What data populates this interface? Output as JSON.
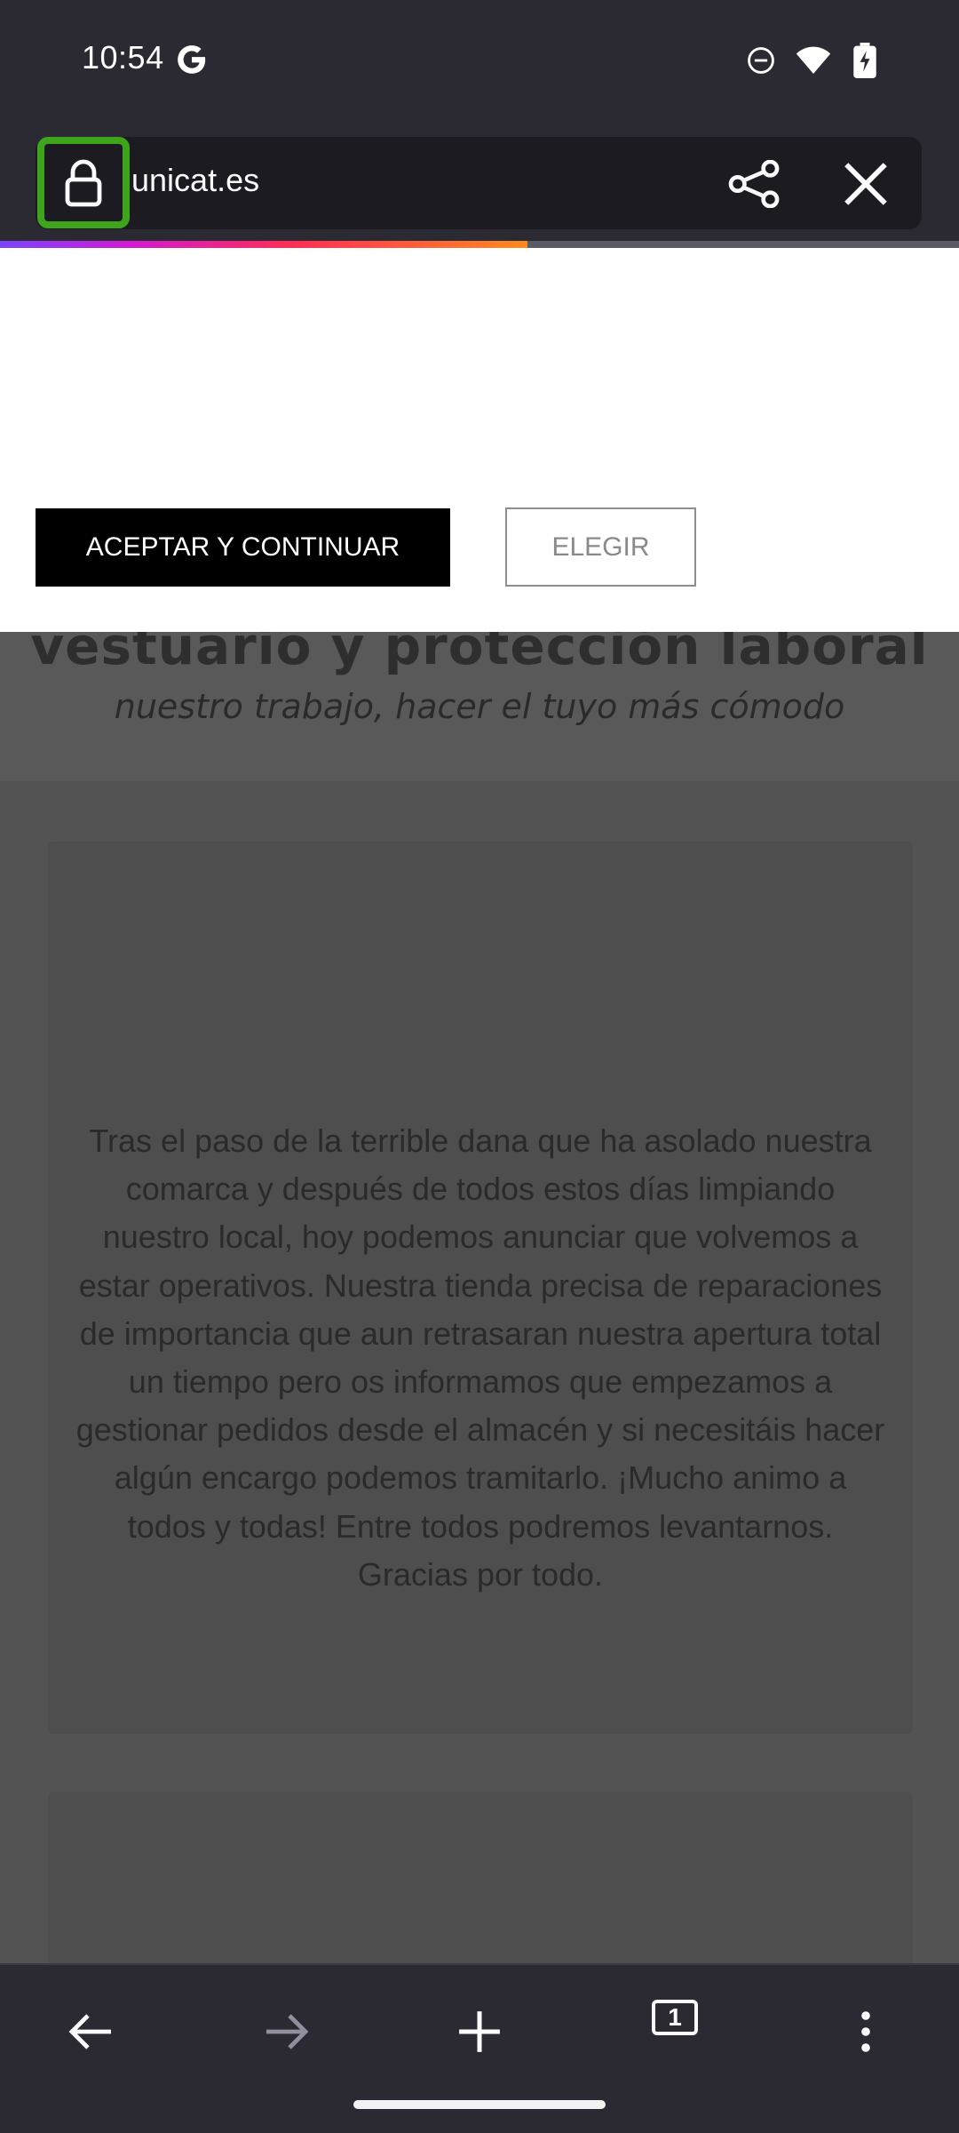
{
  "status_bar": {
    "time": "10:54",
    "icons": [
      "google-g-icon",
      "do-not-disturb-icon",
      "wifi-icon",
      "battery-charging-icon"
    ]
  },
  "browser": {
    "url": "unicat.es",
    "progress_fraction": 0.55,
    "accent_lock_highlight": "#3ea41c",
    "tab_count": "1"
  },
  "consent": {
    "accept_label": "ACEPTAR Y CONTINUAR",
    "choose_label": "ELEGIR"
  },
  "page": {
    "headline": "vestuario y protección laboral",
    "tagline": "nuestro trabajo, hacer el tuyo más cómodo",
    "notice": "Tras el paso de la terrible dana que ha asolado nuestra comarca y después de todos estos días limpiando nuestro local, hoy podemos anunciar que volvemos a estar operativos. Nuestra tienda precisa de reparaciones de importancia que aun retrasaran nuestra apertura total un tiempo pero os informamos que empezamos a gestionar pedidos desde el almacén y si necesitáis hacer algún encargo podemos tramitarlo. ¡Mucho animo a todos y todas! Entre todos podremos levantarnos. Gracias por todo."
  },
  "toolbar": {
    "icons": [
      "back-arrow-icon",
      "forward-arrow-icon",
      "new-tab-plus-icon",
      "tabs-counter-icon",
      "more-menu-icon"
    ]
  }
}
